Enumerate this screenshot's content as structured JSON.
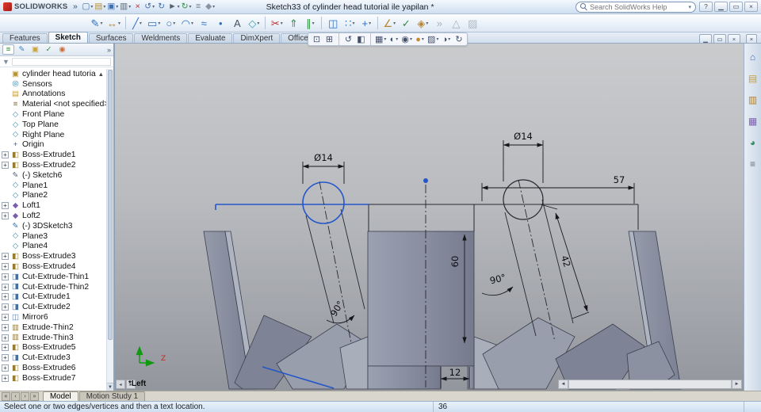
{
  "titlebar": {
    "app_name": "SOLIDWORKS",
    "document_title": "Sketch33 of cylinder head tutorial ile yapilan *",
    "search_placeholder": "Search SolidWorks Help",
    "quick_icons": [
      {
        "name": "menu-expand",
        "glyph": "»",
        "color": "#35506e"
      },
      {
        "name": "new-document",
        "glyph": "▢",
        "color": "#4c6f9e",
        "dd": true
      },
      {
        "name": "open-document",
        "glyph": "▤",
        "color": "#b8912f",
        "dd": true
      },
      {
        "name": "save-document",
        "glyph": "▣",
        "color": "#3f6fae",
        "dd": true
      },
      {
        "name": "print-document",
        "glyph": "▥",
        "color": "#5a6675",
        "dd": true
      },
      {
        "name": "delete",
        "glyph": "×",
        "color": "#b03030"
      },
      {
        "name": "undo",
        "glyph": "↺",
        "color": "#3f6fae",
        "dd": true
      },
      {
        "name": "redo",
        "glyph": "↻",
        "color": "#3f6fae"
      },
      {
        "name": "select",
        "glyph": "►",
        "color": "#55606e",
        "dd": true
      },
      {
        "name": "rebuild",
        "glyph": "↻",
        "color": "#2f8f3f",
        "dd": true
      },
      {
        "name": "file-properties",
        "glyph": "≡",
        "color": "#6b7686"
      },
      {
        "name": "options",
        "glyph": "◆",
        "color": "#8a93a1",
        "dd": true
      }
    ],
    "window_buttons": [
      {
        "name": "help",
        "glyph": "?"
      },
      {
        "name": "minimize",
        "glyph": "▁"
      },
      {
        "name": "maximize",
        "glyph": "▭"
      },
      {
        "name": "close",
        "glyph": "×"
      }
    ]
  },
  "sketch_toolbar": [
    {
      "name": "sketch",
      "glyph": "✎",
      "color": "#2f6fc0",
      "dd": true
    },
    {
      "name": "smart-dimension",
      "glyph": "↔",
      "color": "#b8862f",
      "dd": true
    },
    {
      "sep": true
    },
    {
      "name": "line",
      "glyph": "╱",
      "color": "#2f6fc0",
      "dd": true
    },
    {
      "name": "rectangle",
      "glyph": "▭",
      "color": "#2f6fc0",
      "dd": true
    },
    {
      "name": "circle",
      "glyph": "○",
      "color": "#2f6fc0",
      "dd": true
    },
    {
      "name": "arc",
      "glyph": "◠",
      "color": "#2f6fc0",
      "dd": true
    },
    {
      "name": "spline",
      "glyph": "≈",
      "color": "#2f6fc0"
    },
    {
      "name": "point",
      "glyph": "•",
      "color": "#2f6fc0"
    },
    {
      "name": "text",
      "glyph": "A",
      "color": "#45505e"
    },
    {
      "name": "reference-plane",
      "glyph": "◇",
      "color": "#3f9fae",
      "dd": true
    },
    {
      "sep": true
    },
    {
      "name": "trim-entities",
      "glyph": "✂",
      "color": "#b03030",
      "dd": true
    },
    {
      "name": "convert-entities",
      "glyph": "⇑",
      "color": "#2f8f3f"
    },
    {
      "name": "offset-entities",
      "glyph": "∥",
      "color": "#2f8f3f",
      "dd": true
    },
    {
      "sep": true
    },
    {
      "name": "mirror-entities",
      "glyph": "◫",
      "color": "#2f6fc0"
    },
    {
      "name": "linear-sketch-pattern",
      "glyph": "∷",
      "color": "#2f6fc0",
      "dd": true
    },
    {
      "name": "move-entities",
      "glyph": "+",
      "color": "#2f6fc0",
      "dd": true
    },
    {
      "sep": true
    },
    {
      "name": "display-delete-relations",
      "glyph": "∠",
      "color": "#b8862f",
      "dd": true
    },
    {
      "name": "repair-sketch",
      "glyph": "✓",
      "color": "#2f8f3f"
    },
    {
      "name": "quick-snaps",
      "glyph": "◈",
      "color": "#b8862f",
      "dd": true
    },
    {
      "name": "rapid-sketch",
      "glyph": "»",
      "color": "#55606e",
      "dim": true
    },
    {
      "name": "instant3d",
      "glyph": "△",
      "color": "#55606e",
      "dim": true
    },
    {
      "name": "shaded-sketch-contours",
      "glyph": "▨",
      "color": "#6a7486",
      "dim": true
    }
  ],
  "command_tabs": [
    {
      "label": "Features",
      "active": false
    },
    {
      "label": "Sketch",
      "active": true
    },
    {
      "label": "Surfaces",
      "active": false
    },
    {
      "label": "Weldments",
      "active": false
    },
    {
      "label": "Evaluate",
      "active": false
    },
    {
      "label": "DimXpert",
      "active": false
    },
    {
      "label": "Office Products",
      "active": false
    }
  ],
  "headsup": [
    {
      "name": "zoom-fit",
      "glyph": "⊡"
    },
    {
      "name": "zoom-area",
      "glyph": "⊞"
    },
    {
      "sep": true
    },
    {
      "name": "previous-view",
      "glyph": "↺"
    },
    {
      "name": "section-view",
      "glyph": "◧"
    },
    {
      "sep": true
    },
    {
      "name": "view-orientation",
      "glyph": "▦",
      "dd": true
    },
    {
      "name": "display-style",
      "glyph": "◐",
      "dd": true
    },
    {
      "name": "hide-show-items",
      "glyph": "◉",
      "dd": true
    },
    {
      "name": "edit-appearance",
      "glyph": "●",
      "color": "#c98a2f",
      "dd": true
    },
    {
      "name": "apply-scene",
      "glyph": "▨",
      "dd": true
    },
    {
      "name": "view-settings",
      "glyph": "◑",
      "dd": true
    },
    {
      "name": "rotate-view",
      "glyph": "↻"
    }
  ],
  "doc_window_buttons": [
    {
      "name": "doc-minimize",
      "glyph": "▁"
    },
    {
      "name": "doc-restore",
      "glyph": "▭"
    },
    {
      "name": "doc-close",
      "glyph": "×"
    }
  ],
  "tree": {
    "header_tabs": [
      {
        "name": "featuremanager-tab",
        "glyph": "≡",
        "color": "#3f8f3f"
      },
      {
        "name": "propertymanager-tab",
        "glyph": "✎",
        "color": "#3f7fbf"
      },
      {
        "name": "configurationmanager-tab",
        "glyph": "▣",
        "color": "#caa43c"
      },
      {
        "name": "dimxpertmanager-tab",
        "glyph": "✓",
        "color": "#2f8f3f"
      },
      {
        "name": "displaymanager-tab",
        "glyph": "◉",
        "color": "#d06a2f"
      }
    ],
    "chevron": "»",
    "collapse_arrow": "▲",
    "scroll_down": "▼",
    "items": [
      {
        "label": "cylinder head tutorial ile yapilan",
        "icon": "part",
        "glyph": "▣",
        "color": "#b8912f",
        "root": true
      },
      {
        "label": "Sensors",
        "icon": "sensors",
        "glyph": "◎",
        "color": "#2f7fa8"
      },
      {
        "label": "Annotations",
        "icon": "annotations",
        "glyph": "▤",
        "color": "#c9a03a"
      },
      {
        "label": "Material <not specified>",
        "icon": "material",
        "glyph": "≡",
        "color": "#8a6d3b"
      },
      {
        "label": "Front Plane",
        "icon": "plane",
        "glyph": "◇",
        "color": "#3f8fae"
      },
      {
        "label": "Top Plane",
        "icon": "plane",
        "glyph": "◇",
        "color": "#3f8fae"
      },
      {
        "label": "Right Plane",
        "icon": "plane",
        "glyph": "◇",
        "color": "#3f8fae"
      },
      {
        "label": "Origin",
        "icon": "origin",
        "glyph": "+",
        "color": "#2f5fbf"
      },
      {
        "label": "Boss-Extrude1",
        "icon": "boss-extrude",
        "glyph": "◧",
        "color": "#9a7c2e",
        "expand": true
      },
      {
        "label": "Boss-Extrude2",
        "icon": "boss-extrude",
        "glyph": "◧",
        "color": "#9a7c2e",
        "expand": true
      },
      {
        "label": "(-) Sketch6",
        "icon": "sketch",
        "glyph": "✎",
        "color": "#56617a"
      },
      {
        "label": "Plane1",
        "icon": "plane",
        "glyph": "◇",
        "color": "#3f8fae"
      },
      {
        "label": "Plane2",
        "icon": "plane",
        "glyph": "◇",
        "color": "#3f8fae"
      },
      {
        "label": "Loft1",
        "icon": "loft",
        "glyph": "◆",
        "color": "#7a5faf",
        "expand": true
      },
      {
        "label": "Loft2",
        "icon": "loft",
        "glyph": "◆",
        "color": "#7a5faf",
        "expand": true
      },
      {
        "label": "(-) 3DSketch3",
        "icon": "3d-sketch",
        "glyph": "✎",
        "color": "#2f6faf"
      },
      {
        "label": "Plane3",
        "icon": "plane",
        "glyph": "◇",
        "color": "#3f8fae"
      },
      {
        "label": "Plane4",
        "icon": "plane",
        "glyph": "◇",
        "color": "#3f8fae"
      },
      {
        "label": "Boss-Extrude3",
        "icon": "boss-extrude",
        "glyph": "◧",
        "color": "#9a7c2e",
        "expand": true
      },
      {
        "label": "Boss-Extrude4",
        "icon": "boss-extrude",
        "glyph": "◧",
        "color": "#9a7c2e",
        "expand": true
      },
      {
        "label": "Cut-Extrude-Thin1",
        "icon": "cut-extrude",
        "glyph": "◨",
        "color": "#46709f",
        "expand": true
      },
      {
        "label": "Cut-Extrude-Thin2",
        "icon": "cut-extrude",
        "glyph": "◨",
        "color": "#46709f",
        "expand": true
      },
      {
        "label": "Cut-Extrude1",
        "icon": "cut-extrude",
        "glyph": "◨",
        "color": "#46709f",
        "expand": true
      },
      {
        "label": "Cut-Extrude2",
        "icon": "cut-extrude",
        "glyph": "◨",
        "color": "#46709f",
        "expand": true
      },
      {
        "label": "Mirror6",
        "icon": "mirror",
        "glyph": "◫",
        "color": "#4a7fc0",
        "expand": true
      },
      {
        "label": "Extrude-Thin2",
        "icon": "extrude-thin",
        "glyph": "▥",
        "color": "#9a7c2e",
        "expand": true
      },
      {
        "label": "Extrude-Thin3",
        "icon": "extrude-thin",
        "glyph": "▥",
        "color": "#9a7c2e",
        "expand": true
      },
      {
        "label": "Boss-Extrude5",
        "icon": "boss-extrude",
        "glyph": "◧",
        "color": "#9a7c2e",
        "expand": true
      },
      {
        "label": "Cut-Extrude3",
        "icon": "cut-extrude",
        "glyph": "◨",
        "color": "#46709f",
        "expand": true
      },
      {
        "label": "Boss-Extrude6",
        "icon": "boss-extrude",
        "glyph": "◧",
        "color": "#9a7c2e",
        "expand": true
      },
      {
        "label": "Boss-Extrude7",
        "icon": "boss-extrude",
        "glyph": "◧",
        "color": "#9a7c2e",
        "expand": true
      }
    ]
  },
  "viewport": {
    "view_label": "*Left",
    "axis_label": "Z",
    "dims": {
      "left_circle_dia": "Ø14",
      "right_circle_dia": "Ø14",
      "top_width": "57",
      "cylinder_height": "60",
      "valve_length": "42",
      "left_angle": "90°",
      "right_angle": "90°",
      "bottom_gap": "12"
    }
  },
  "taskpane": [
    {
      "name": "solidworks-resources",
      "glyph": "⌂",
      "color": "#3f6fbf"
    },
    {
      "name": "design-library",
      "glyph": "▤",
      "color": "#c9a03a"
    },
    {
      "name": "file-explorer",
      "glyph": "▥",
      "color": "#b0822f"
    },
    {
      "name": "view-palette",
      "glyph": "▦",
      "color": "#7a5faf"
    },
    {
      "name": "appearances-scenes",
      "glyph": "◕",
      "color": "#2f8f5f"
    },
    {
      "name": "custom-properties",
      "glyph": "≡",
      "color": "#5f6f7f"
    }
  ],
  "doc_tabs": {
    "nav": [
      "«",
      "‹",
      "›",
      "»"
    ],
    "items": [
      {
        "label": "Model",
        "active": true
      },
      {
        "label": "Motion Study 1",
        "active": false
      }
    ]
  },
  "statusbar": {
    "message": "Select one or two edges/vertices and then a text location.",
    "value": "36"
  }
}
